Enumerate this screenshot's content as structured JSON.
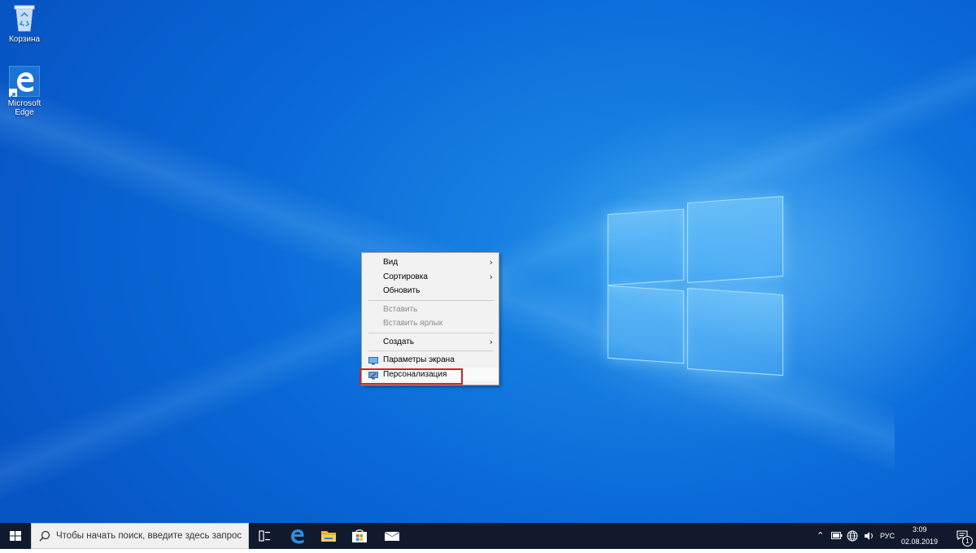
{
  "desktop": {
    "icons": [
      {
        "label": "Корзина"
      },
      {
        "label_line1": "Microsoft",
        "label_line2": "Edge"
      }
    ]
  },
  "context_menu": {
    "items": [
      {
        "label": "Вид",
        "has_submenu": true,
        "enabled": true
      },
      {
        "label": "Сортировка",
        "has_submenu": true,
        "enabled": true
      },
      {
        "label": "Обновить",
        "has_submenu": false,
        "enabled": true
      },
      {
        "label": "Вставить",
        "has_submenu": false,
        "enabled": false
      },
      {
        "label": "Вставить ярлык",
        "has_submenu": false,
        "enabled": false
      },
      {
        "label": "Создать",
        "has_submenu": true,
        "enabled": true
      },
      {
        "label": "Параметры экрана",
        "has_submenu": false,
        "enabled": true,
        "icon": "display-settings-icon"
      },
      {
        "label": "Персонализация",
        "has_submenu": false,
        "enabled": true,
        "icon": "personalization-icon",
        "highlighted": true
      }
    ],
    "submenu_arrow": "›"
  },
  "taskbar": {
    "search_placeholder": "Чтобы начать поиск, введите здесь запрос",
    "pinned": [
      "task-view-icon",
      "edge-icon",
      "file-explorer-icon",
      "store-icon",
      "mail-icon"
    ],
    "tray": {
      "language": "РУС",
      "time": "3:09",
      "date": "02.08.2019",
      "notification_count": "1"
    }
  },
  "colors": {
    "desktop_blue": "#0a6ad8",
    "taskbar": "#101a2c",
    "highlight_box": "#d41f1f",
    "menu_bg": "#f2f2f2"
  }
}
